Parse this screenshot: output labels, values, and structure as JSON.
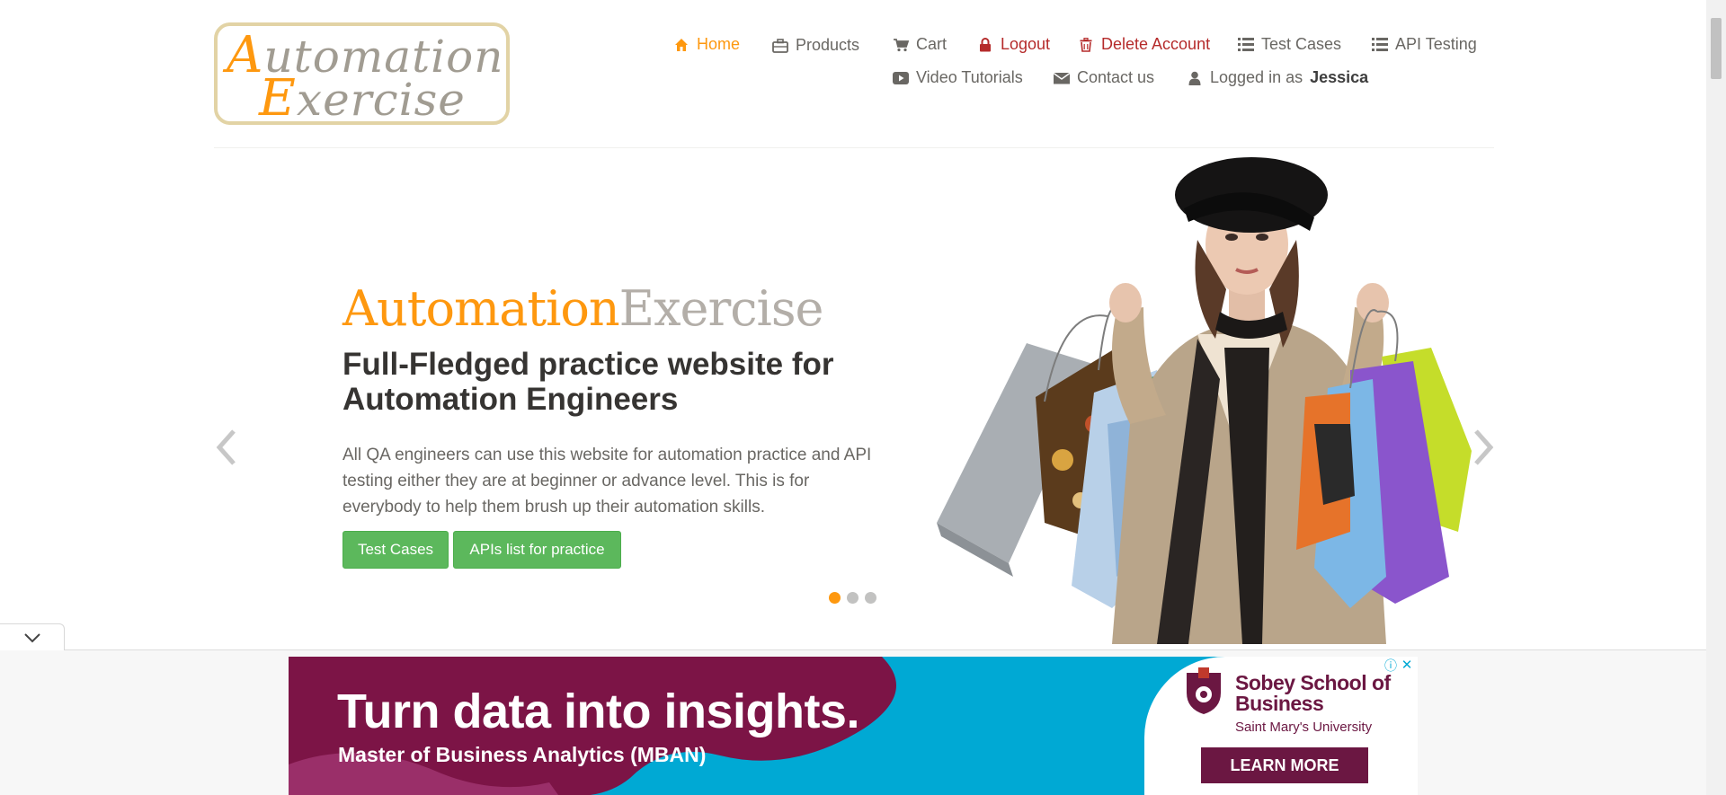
{
  "header": {
    "logo": {
      "line1_cap": "A",
      "line1_rest": "utomation",
      "line2_cap": "E",
      "line2_rest": "xercise"
    },
    "nav": [
      {
        "label": "Home",
        "icon": "home-icon"
      },
      {
        "label": "Products",
        "icon": "briefcase-icon"
      },
      {
        "label": "Cart",
        "icon": "cart-icon"
      },
      {
        "label": "Logout",
        "icon": "lock-icon"
      },
      {
        "label": "Delete Account",
        "icon": "trash-icon"
      },
      {
        "label": "Test Cases",
        "icon": "list-icon"
      },
      {
        "label": "API Testing",
        "icon": "list-icon"
      },
      {
        "label": "Video Tutorials",
        "icon": "youtube-play-icon"
      },
      {
        "label": "Contact us",
        "icon": "envelope-icon"
      },
      {
        "label_prefix": "Logged in as",
        "username": "Jessica",
        "icon": "user-icon"
      }
    ]
  },
  "slider": {
    "title_part1": "Automation",
    "title_part2": "Exercise",
    "subtitle": "Full-Fledged practice website for Automation Engineers",
    "description": "All QA engineers can use this website for automation practice and API testing either they are at beginner or advance level. This is for everybody to help them brush up their automation skills.",
    "buttons": {
      "test_cases": "Test Cases",
      "apis": "APIs list for practice"
    },
    "active_slide": 1,
    "slide_count": 3
  },
  "ad": {
    "headline": "Turn data into insights.",
    "sub": "Master of Business Analytics (MBAN)",
    "school": "Sobey School of Business",
    "university": "Saint Mary's University",
    "cta": "LEARN MORE"
  },
  "colors": {
    "accent": "#FE980F",
    "danger": "#b52b2b",
    "button": "#5cb85c",
    "ad_bg": "#00a9d4",
    "ad_maroon": "#6b1742"
  }
}
